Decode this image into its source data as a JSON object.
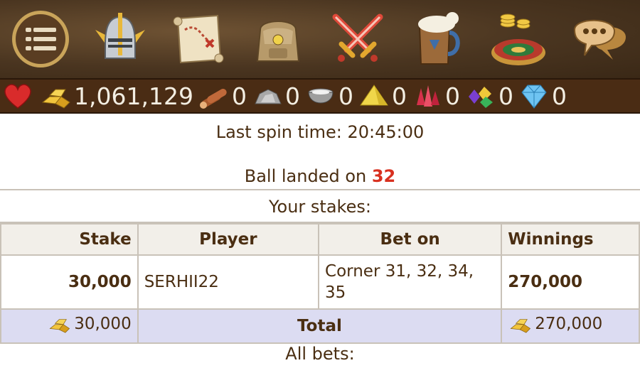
{
  "nav": {
    "items": [
      {
        "name": "menu-button",
        "icon": "menu-icon"
      },
      {
        "name": "knight-helmet-button",
        "icon": "helmet-icon"
      },
      {
        "name": "map-button",
        "icon": "map-icon"
      },
      {
        "name": "backpack-button",
        "icon": "backpack-icon"
      },
      {
        "name": "battle-button",
        "icon": "crossed-swords-icon"
      },
      {
        "name": "tavern-button",
        "icon": "beer-mug-icon"
      },
      {
        "name": "roulette-button",
        "icon": "roulette-icon"
      },
      {
        "name": "chat-button",
        "icon": "chat-icon"
      }
    ]
  },
  "resources": {
    "gold": "1,061,129",
    "wood": "0",
    "stone": "0",
    "iron": "0",
    "sulfur": "0",
    "ruby": "0",
    "gems": "0",
    "diamond": "0"
  },
  "spin": {
    "last_spin_label": "Last spin time: 20:45:00",
    "ball_label": "Ball landed on",
    "ball_number": "32"
  },
  "stakes": {
    "title": "Your stakes:",
    "headers": {
      "stake": "Stake",
      "player": "Player",
      "bet_on": "Bet on",
      "winnings": "Winnings"
    },
    "rows": [
      {
        "stake": "30,000",
        "player": "SERHII22",
        "bet_on": "Corner 31, 32, 34, 35",
        "winnings": "270,000"
      }
    ],
    "total": {
      "stake": "30,000",
      "label": "Total",
      "winnings": "270,000"
    }
  },
  "all_bets_label": "All bets:",
  "colors": {
    "accent_red": "#d8301f",
    "total_row_bg": "#dcdcf2",
    "resource_bar": "#4a2c14"
  }
}
